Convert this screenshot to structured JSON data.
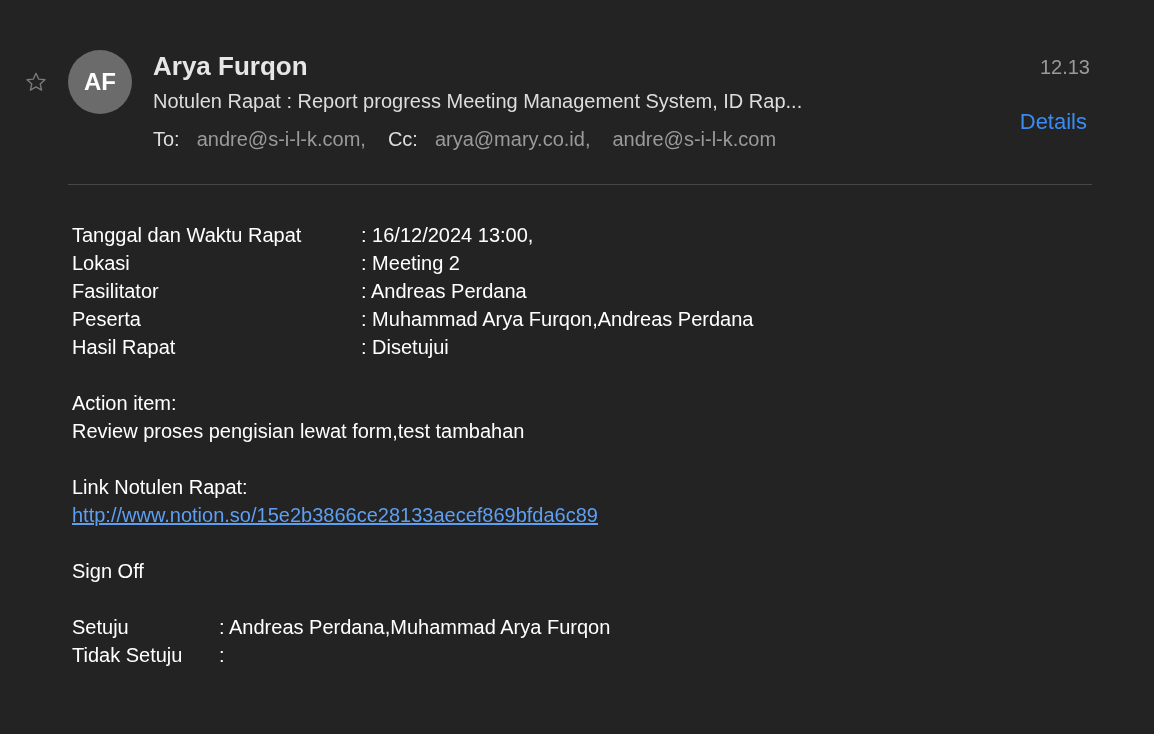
{
  "message": {
    "starred": false,
    "initials": "AF",
    "sender": "Arya Furqon",
    "time": "12.13",
    "subject": "Notulen Rapat : Report progress Meeting Management System, ID Rap...",
    "details": "Details",
    "recipients": [
      {
        "label": "To:",
        "addresses": [
          "andre@s-i-l-k.com,"
        ]
      },
      {
        "label": "Cc:",
        "addresses": [
          "arya@mary.co.id,",
          "andre@s-i-l-k.com"
        ]
      }
    ]
  },
  "body": [
    {
      "kind": "fields",
      "rows": [
        {
          "label": "Tanggal dan Waktu Rapat",
          "value": ": 16/12/2024 13:00,"
        },
        {
          "label": "Lokasi",
          "value": ": Meeting 2"
        },
        {
          "label": "Fasilitator",
          "value": ": Andreas Perdana"
        },
        {
          "label": "Peserta",
          "value": ": Muhammad Arya Furqon,Andreas Perdana"
        },
        {
          "label": "Hasil Rapat",
          "value": ": Disetujui"
        }
      ]
    },
    {
      "kind": "text",
      "lines": [
        "Action item:",
        "Review proses pengisian lewat form,test tambahan"
      ]
    },
    {
      "kind": "link",
      "label": "Link Notulen Rapat:",
      "url": "http://www.notion.so/15e2b3866ce28133aecef869bfda6c89"
    },
    {
      "kind": "text",
      "lines": [
        "Sign Off"
      ]
    },
    {
      "kind": "short-fields",
      "rows": [
        {
          "label": "Setuju",
          "value": ": Andreas Perdana,Muhammad Arya Furqon"
        },
        {
          "label": "Tidak Setuju",
          "value": ":"
        }
      ]
    }
  ]
}
